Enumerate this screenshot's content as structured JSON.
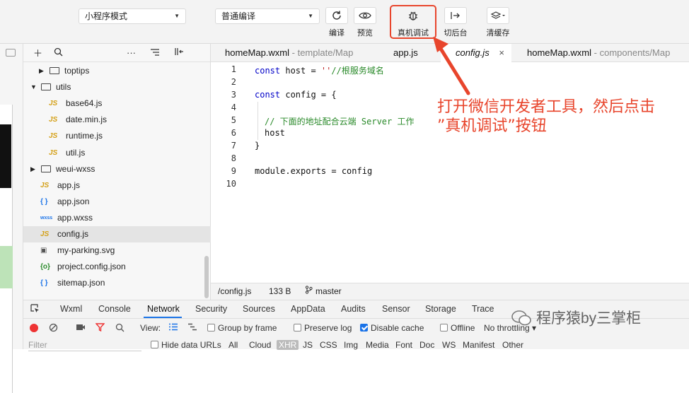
{
  "toolbar": {
    "mode_select": "小程序模式",
    "compile_select": "普通编译",
    "buttons": [
      {
        "label": "编译",
        "icon": "refresh-icon"
      },
      {
        "label": "预览",
        "icon": "eye-icon"
      },
      {
        "label": "真机调试",
        "icon": "bug-icon"
      },
      {
        "label": "切后台",
        "icon": "switch-background-icon"
      },
      {
        "label": "清缓存",
        "icon": "layers-icon"
      }
    ]
  },
  "explorer": {
    "items": [
      {
        "label": "toptips",
        "type": "folder",
        "indent": 1,
        "open": false
      },
      {
        "label": "utils",
        "type": "folder",
        "indent": 0,
        "open": true
      },
      {
        "label": "base64.js",
        "type": "js",
        "indent": 2
      },
      {
        "label": "date.min.js",
        "type": "js",
        "indent": 2
      },
      {
        "label": "runtime.js",
        "type": "js",
        "indent": 2
      },
      {
        "label": "util.js",
        "type": "js",
        "indent": 2
      },
      {
        "label": "weui-wxss",
        "type": "folder",
        "indent": 0,
        "open": false
      },
      {
        "label": "app.js",
        "type": "js",
        "indent": 1
      },
      {
        "label": "app.json",
        "type": "json",
        "indent": 1
      },
      {
        "label": "app.wxss",
        "type": "wxss",
        "indent": 1
      },
      {
        "label": "config.js",
        "type": "js",
        "indent": 1,
        "selected": true
      },
      {
        "label": "my-parking.svg",
        "type": "svg",
        "indent": 1
      },
      {
        "label": "project.config.json",
        "type": "config",
        "indent": 1
      },
      {
        "label": "sitemap.json",
        "type": "json",
        "indent": 1
      }
    ],
    "icon_glyphs": {
      "js": "JS",
      "json": "{ }",
      "wxss": "wxss",
      "config": "{o}",
      "svg": "▣"
    }
  },
  "editor": {
    "tabs": [
      {
        "name": "homeMap.wxml",
        "path": " - template/Map"
      },
      {
        "name": "app.js",
        "path": ""
      },
      {
        "name": "config.js",
        "path": "",
        "active": true,
        "close": "×"
      },
      {
        "name": "homeMap.wxml",
        "path": " - components/Map"
      }
    ],
    "line_numbers": [
      "1",
      "2",
      "3",
      "4",
      "5",
      "6",
      "7",
      "8",
      "9",
      "10"
    ],
    "code": {
      "l1_kw": "const",
      "l1_rest": " host = ",
      "l1_str": "''",
      "l1_cm": "//根服务域名",
      "l3_kw": "const",
      "l3_rest": " config = {",
      "l5_cm": "// 下面的地址配合云端 Server 工作",
      "l6": "host",
      "l7": "}",
      "l9": "module.exports = config"
    },
    "status": {
      "file": "/config.js",
      "size": "133 B",
      "branch": "master"
    }
  },
  "devtools": {
    "tabs": [
      "Wxml",
      "Console",
      "Network",
      "Security",
      "Sources",
      "AppData",
      "Audits",
      "Sensor",
      "Storage",
      "Trace"
    ],
    "active_tab": "Network",
    "view_label": "View:",
    "group_by_frame": "Group by frame",
    "preserve_log": "Preserve log",
    "disable_cache": "Disable cache",
    "offline": "Offline",
    "throttling": "No throttling",
    "filter_placeholder": "Filter",
    "hide_data_urls": "Hide data URLs",
    "filter_types": [
      "All",
      "Cloud",
      "XHR",
      "JS",
      "CSS",
      "Img",
      "Media",
      "Font",
      "Doc",
      "WS",
      "Manifest",
      "Other"
    ]
  },
  "annotation": {
    "line1": "打开微信开发者工具，然后点击",
    "line2": "”真机调试”按钮"
  },
  "watermark": "程序猿by三掌柜",
  "colors": {
    "accent_red": "#e8452c",
    "network_blue": "#1a73e8",
    "js_icon": "#d4a017"
  }
}
